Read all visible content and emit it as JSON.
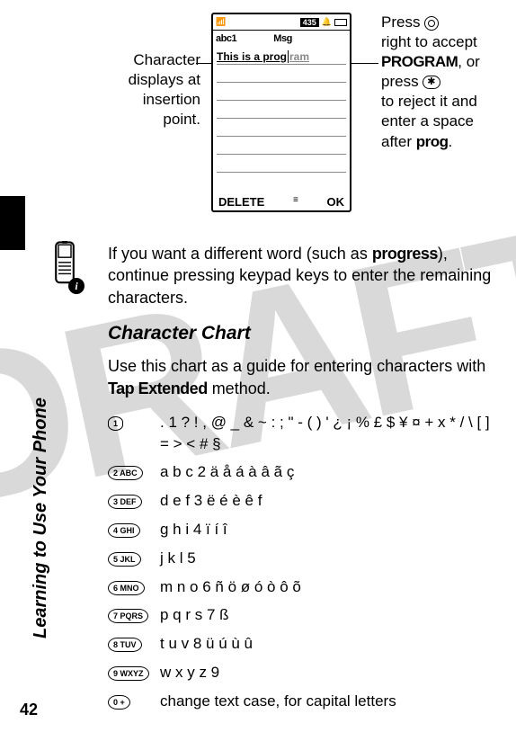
{
  "page_number": "42",
  "sidebar_title": "Learning to Use Your Phone",
  "figure": {
    "left_note_l1": "Character",
    "left_note_l2": "displays at",
    "left_note_l3": "insertion point.",
    "right_note_l1": "Press ",
    "right_note_l2": "right to accept ",
    "right_note_word1": "PROGRAM",
    "right_note_l3": ", or press ",
    "right_note_l4": " to reject it and enter a space after ",
    "right_note_word2": "prog",
    "right_note_l5": ".",
    "screen": {
      "status_count": "435",
      "mode": "abc1",
      "title": "Msg",
      "line_typed": "This is a prog",
      "line_suggest": "ram",
      "soft_left": "DELETE",
      "soft_right": "OK"
    }
  },
  "tip_paragraph_a": "If you want a different word (such as ",
  "tip_word": "progress",
  "tip_paragraph_b": "), continue pressing keypad keys to enter the remaining characters.",
  "section_heading": "Character Chart",
  "chart_intro_a": "Use this chart as a guide for entering characters with ",
  "chart_intro_method": "Tap Extended",
  "chart_intro_b": " method.",
  "chart": {
    "k1": "1",
    "v1": ". 1 ? ! , @ _ & ~ : ; \" - ( ) ' ¿ ¡ % £ $ ¥ ¤    + x * / \\ [ ] = > < # §",
    "k2": "2 ABC",
    "v2": "a b c 2 ä å á à â ã      ç",
    "k3": "3 DEF",
    "v3": "d e f 3   ë é è ê f",
    "k4": "4 GHI",
    "v4": "g h i 4 ï í î",
    "k5": "5 JKL",
    "v5": "j k l 5",
    "k6": "6 MNO",
    "v6": "m n o 6 ñ ö ø ó ò ô õ",
    "k7": "7 PQRS",
    "v7": "p q r s 7   ß",
    "k8": "8 TUV",
    "v8": "t u v 8   ü ú ù û",
    "k9": "9 WXYZ",
    "v9": "w x y z 9",
    "k0": "0 +",
    "v0": "change text case, for capital letters"
  }
}
